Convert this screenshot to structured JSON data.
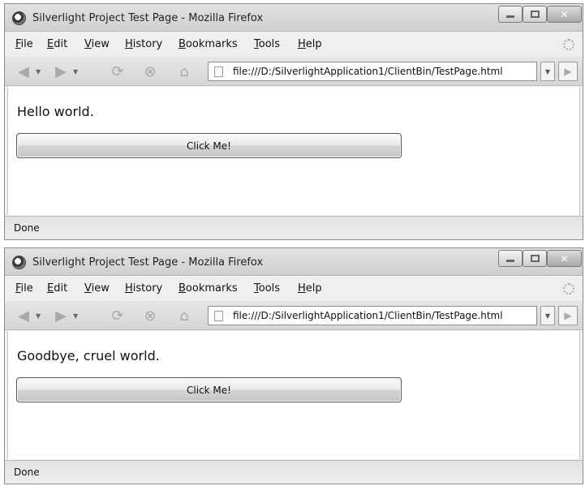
{
  "windows": [
    {
      "title": "Silverlight Project Test Page - Mozilla Firefox",
      "menu": [
        "File",
        "Edit",
        "View",
        "History",
        "Bookmarks",
        "Tools",
        "Help"
      ],
      "url": "file:///D:/SilverlightApplication1/ClientBin/TestPage.html",
      "message": "Hello world.",
      "button_label": "Click Me!",
      "status": "Done"
    },
    {
      "title": "Silverlight Project Test Page - Mozilla Firefox",
      "menu": [
        "File",
        "Edit",
        "View",
        "History",
        "Bookmarks",
        "Tools",
        "Help"
      ],
      "url": "file:///D:/SilverlightApplication1/ClientBin/TestPage.html",
      "message": "Goodbye, cruel world.",
      "button_label": "Click Me!",
      "status": "Done"
    }
  ],
  "icons": {
    "app": "firefox-icon",
    "minimize": "minimize-icon",
    "maximize": "maximize-icon",
    "close": "close-icon",
    "back": "back-arrow-icon",
    "forward": "forward-arrow-icon",
    "reload": "reload-icon",
    "stop": "stop-icon",
    "home": "home-icon",
    "page": "page-icon",
    "go": "go-icon",
    "activity": "throbber-icon"
  }
}
